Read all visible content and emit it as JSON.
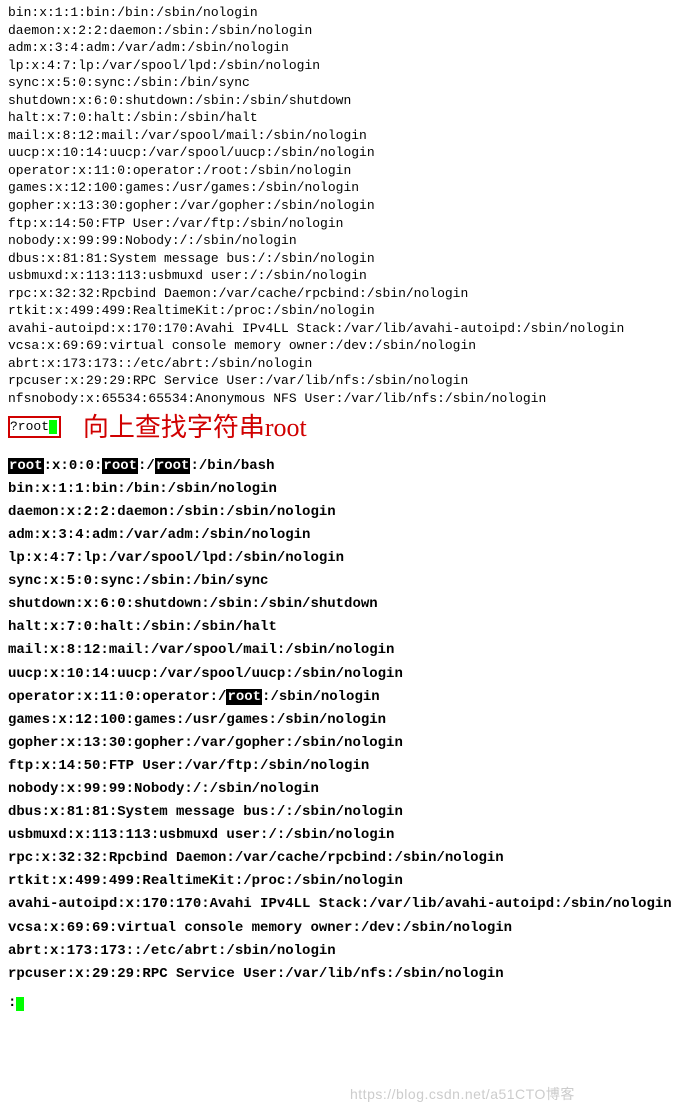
{
  "top_lines": [
    "bin:x:1:1:bin:/bin:/sbin/nologin",
    "daemon:x:2:2:daemon:/sbin:/sbin/nologin",
    "adm:x:3:4:adm:/var/adm:/sbin/nologin",
    "lp:x:4:7:lp:/var/spool/lpd:/sbin/nologin",
    "sync:x:5:0:sync:/sbin:/bin/sync",
    "shutdown:x:6:0:shutdown:/sbin:/sbin/shutdown",
    "halt:x:7:0:halt:/sbin:/sbin/halt",
    "mail:x:8:12:mail:/var/spool/mail:/sbin/nologin",
    "uucp:x:10:14:uucp:/var/spool/uucp:/sbin/nologin",
    "operator:x:11:0:operator:/root:/sbin/nologin",
    "games:x:12:100:games:/usr/games:/sbin/nologin",
    "gopher:x:13:30:gopher:/var/gopher:/sbin/nologin",
    "ftp:x:14:50:FTP User:/var/ftp:/sbin/nologin",
    "nobody:x:99:99:Nobody:/:/sbin/nologin",
    "dbus:x:81:81:System message bus:/:/sbin/nologin",
    "usbmuxd:x:113:113:usbmuxd user:/:/sbin/nologin",
    "rpc:x:32:32:Rpcbind Daemon:/var/cache/rpcbind:/sbin/nologin",
    "rtkit:x:499:499:RealtimeKit:/proc:/sbin/nologin",
    "avahi-autoipd:x:170:170:Avahi IPv4LL Stack:/var/lib/avahi-autoipd:/sbin/nologin",
    "vcsa:x:69:69:virtual console memory owner:/dev:/sbin/nologin",
    "abrt:x:173:173::/etc/abrt:/sbin/nologin",
    "rpcuser:x:29:29:RPC Service User:/var/lib/nfs:/sbin/nologin",
    "nfsnobody:x:65534:65534:Anonymous NFS User:/var/lib/nfs:/sbin/nologin"
  ],
  "search": {
    "text": "?root",
    "annotation": "向上查找字符串root"
  },
  "bottom_lines": [
    {
      "segments": [
        {
          "t": "root",
          "hl": true
        },
        {
          "t": ":x:0:0:"
        },
        {
          "t": "root",
          "hl": true
        },
        {
          "t": ":/"
        },
        {
          "t": "root",
          "hl": true
        },
        {
          "t": ":/bin/bash"
        }
      ]
    },
    {
      "segments": [
        {
          "t": "bin:x:1:1:bin:/bin:/sbin/nologin"
        }
      ]
    },
    {
      "segments": [
        {
          "t": "daemon:x:2:2:daemon:/sbin:/sbin/nologin"
        }
      ]
    },
    {
      "segments": [
        {
          "t": "adm:x:3:4:adm:/var/adm:/sbin/nologin"
        }
      ]
    },
    {
      "segments": [
        {
          "t": "lp:x:4:7:lp:/var/spool/lpd:/sbin/nologin"
        }
      ]
    },
    {
      "segments": [
        {
          "t": "sync:x:5:0:sync:/sbin:/bin/sync"
        }
      ]
    },
    {
      "segments": [
        {
          "t": "shutdown:x:6:0:shutdown:/sbin:/sbin/shutdown"
        }
      ]
    },
    {
      "segments": [
        {
          "t": "halt:x:7:0:halt:/sbin:/sbin/halt"
        }
      ]
    },
    {
      "segments": [
        {
          "t": "mail:x:8:12:mail:/var/spool/mail:/sbin/nologin"
        }
      ]
    },
    {
      "segments": [
        {
          "t": "uucp:x:10:14:uucp:/var/spool/uucp:/sbin/nologin"
        }
      ]
    },
    {
      "segments": [
        {
          "t": "operator:x:11:0:operator:/"
        },
        {
          "t": "root",
          "hl": true
        },
        {
          "t": ":/sbin/nologin"
        }
      ]
    },
    {
      "segments": [
        {
          "t": "games:x:12:100:games:/usr/games:/sbin/nologin"
        }
      ]
    },
    {
      "segments": [
        {
          "t": "gopher:x:13:30:gopher:/var/gopher:/sbin/nologin"
        }
      ]
    },
    {
      "segments": [
        {
          "t": "ftp:x:14:50:FTP User:/var/ftp:/sbin/nologin"
        }
      ]
    },
    {
      "segments": [
        {
          "t": "nobody:x:99:99:Nobody:/:/sbin/nologin"
        }
      ]
    },
    {
      "segments": [
        {
          "t": "dbus:x:81:81:System message bus:/:/sbin/nologin"
        }
      ]
    },
    {
      "segments": [
        {
          "t": "usbmuxd:x:113:113:usbmuxd user:/:/sbin/nologin"
        }
      ]
    },
    {
      "segments": [
        {
          "t": "rpc:x:32:32:Rpcbind Daemon:/var/cache/rpcbind:/sbin/nologin"
        }
      ]
    },
    {
      "segments": [
        {
          "t": "rtkit:x:499:499:RealtimeKit:/proc:/sbin/nologin"
        }
      ]
    },
    {
      "segments": [
        {
          "t": "avahi-autoipd:x:170:170:Avahi IPv4LL Stack:/var/lib/avahi-autoipd:/sbin/nologin"
        }
      ]
    },
    {
      "segments": [
        {
          "t": "vcsa:x:69:69:virtual console memory owner:/dev:/sbin/nologin"
        }
      ]
    },
    {
      "segments": [
        {
          "t": "abrt:x:173:173::/etc/abrt:/sbin/nologin"
        }
      ]
    },
    {
      "segments": [
        {
          "t": "rpcuser:x:29:29:RPC Service User:/var/lib/nfs:/sbin/nologin"
        }
      ]
    }
  ],
  "prompt": {
    "colon": ":"
  },
  "watermark": "https://blog.csdn.net/a51CTO博客"
}
